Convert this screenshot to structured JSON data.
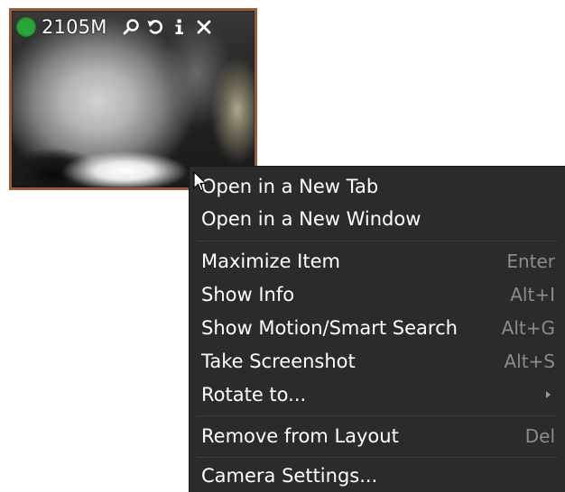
{
  "camera_tile": {
    "name": "2105M",
    "status_color": "#2aa43a",
    "border_color": "#9a5a3c",
    "icons": [
      "search-icon",
      "rotate-icon",
      "info-icon",
      "close-icon"
    ]
  },
  "context_menu": {
    "items": [
      {
        "label": "Open in a New Tab",
        "shortcut": ""
      },
      {
        "label": "Open in a New Window",
        "shortcut": ""
      },
      {
        "label": "Maximize Item",
        "shortcut": "Enter"
      },
      {
        "label": "Show Info",
        "shortcut": "Alt+I"
      },
      {
        "label": "Show Motion/Smart Search",
        "shortcut": "Alt+G"
      },
      {
        "label": "Take Screenshot",
        "shortcut": "Alt+S"
      },
      {
        "label": "Rotate to...",
        "shortcut": "",
        "submenu": true
      },
      {
        "label": "Remove from Layout",
        "shortcut": "Del"
      },
      {
        "label": "Camera Settings...",
        "shortcut": ""
      }
    ]
  }
}
